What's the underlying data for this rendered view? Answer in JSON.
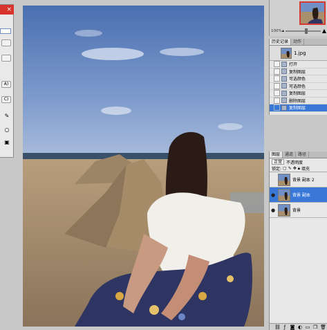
{
  "dialog": {
    "close_glyph": "×",
    "buttons": [
      "",
      "",
      "A)",
      "C)"
    ]
  },
  "navigator": {
    "zoom": "100%",
    "zoom_level": 0.55
  },
  "history": {
    "tabs": [
      "历史记录",
      "动作"
    ],
    "snapshot_name": "1.jpg",
    "steps": [
      {
        "label": "打开",
        "selected": false
      },
      {
        "label": "复制图层",
        "selected": false
      },
      {
        "label": "可选颜色",
        "selected": false
      },
      {
        "label": "可选颜色",
        "selected": false
      },
      {
        "label": "复制图层",
        "selected": false
      },
      {
        "label": "删除图层",
        "selected": false
      },
      {
        "label": "复制图层",
        "selected": true
      }
    ]
  },
  "layers": {
    "tabs": [
      "图层",
      "通道",
      "路径"
    ],
    "blend_mode": "正常",
    "opacity_label": "不透明度",
    "lock_label": "锁定:",
    "fill_label": "填充",
    "items": [
      {
        "name": "背景 副本 2",
        "visible": false,
        "selected": false
      },
      {
        "name": "背景 副本",
        "visible": true,
        "selected": true
      },
      {
        "name": "背景",
        "visible": true,
        "selected": false
      }
    ],
    "footer_icons": [
      "link-icon",
      "fx-icon",
      "mask-icon",
      "adjustment-icon",
      "folder-icon",
      "new-layer-icon",
      "trash-icon"
    ]
  },
  "colors": {
    "selection": "#3a78d8",
    "close_button": "#d9342b",
    "panel_bg": "#d9d9d9"
  }
}
